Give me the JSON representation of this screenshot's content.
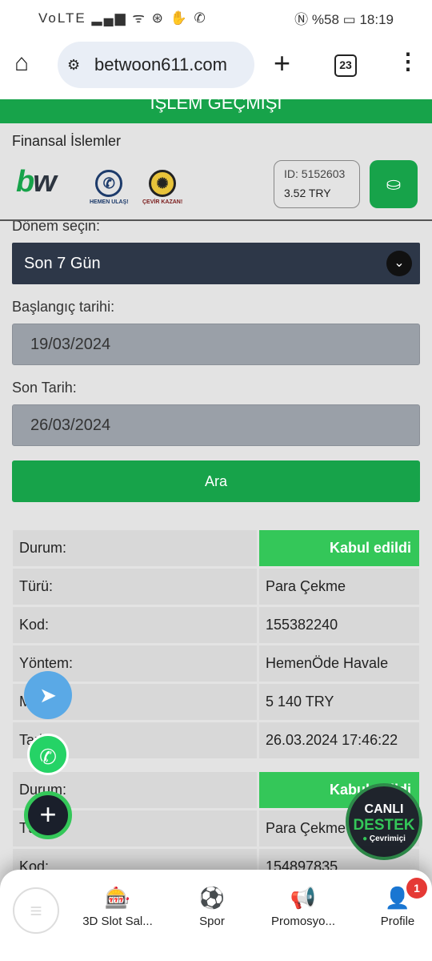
{
  "status_bar": {
    "left": "VoLTE ▂▄▆ ᯤ ⊛ ✋ ✆",
    "battery": "%58",
    "time": "18:19"
  },
  "browser": {
    "url": "betwoon611.com",
    "tab_count": "23"
  },
  "page": {
    "header": "İŞLEM GEÇMİŞİ",
    "section_title": "Finansal İslemler",
    "logo_text": {
      "b": "b",
      "w": "w"
    },
    "hemen_ulas": "HEMEN ULAŞ!",
    "cevir_kazan": "ÇEVİR KAZAN!",
    "account": {
      "id": "ID: 5152603",
      "balance": "3.52 TRY"
    },
    "form": {
      "period_label": "Dönem seçin:",
      "period_value": "Son 7 Gün",
      "start_label": "Başlangıç tarihi:",
      "start_value": "19/03/2024",
      "end_label": "Son Tarih:",
      "end_value": "26/03/2024",
      "search_button": "Ara"
    },
    "transactions": [
      {
        "rows": [
          [
            "Durum:",
            "Kabul edildi"
          ],
          [
            "Türü:",
            "Para Çekme"
          ],
          [
            "Kod:",
            "155382240"
          ],
          [
            "Yöntem:",
            "HemenÖde Havale"
          ],
          [
            "Miktar:",
            "5 140 TRY"
          ],
          [
            "Tarih:",
            "26.03.2024 17:46:22"
          ]
        ]
      },
      {
        "rows": [
          [
            "Durum:",
            "Kabul edildi"
          ],
          [
            "Türü:",
            "Para Çekme"
          ],
          [
            "Kod:",
            "154897835"
          ]
        ]
      }
    ]
  },
  "live_support": {
    "line1": "CANLI",
    "line2": "DESTEK",
    "status": "Çevrimiçi"
  },
  "bottom_nav": {
    "items": [
      {
        "label": "3D Slot Sal...",
        "icon": "slot-machine-icon"
      },
      {
        "label": "Spor",
        "icon": "soccer-ball-icon"
      },
      {
        "label": "Promosyo...",
        "icon": "megaphone-icon"
      },
      {
        "label": "Profile",
        "icon": "user-icon",
        "badge": "1"
      }
    ]
  },
  "colors": {
    "accent": "#17a34a",
    "success": "#34c759",
    "dark": "#2d3748"
  }
}
